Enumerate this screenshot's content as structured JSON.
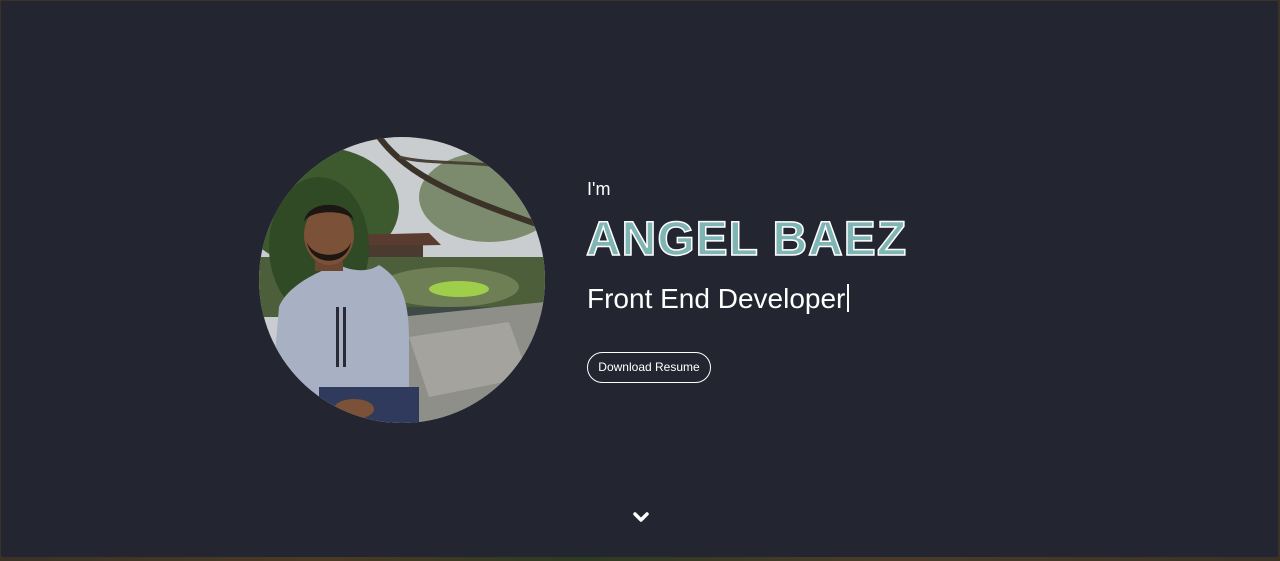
{
  "hero": {
    "intro": "I'm",
    "name": "ANGEL BAEZ",
    "role": "Front End Developer",
    "download_label": "Download Resume",
    "scroll_icon": "chevron-down-icon",
    "avatar_icon": "profile-photo"
  },
  "colors": {
    "background": "#232630",
    "accent": "#7fb6b5",
    "text": "#ffffff"
  }
}
